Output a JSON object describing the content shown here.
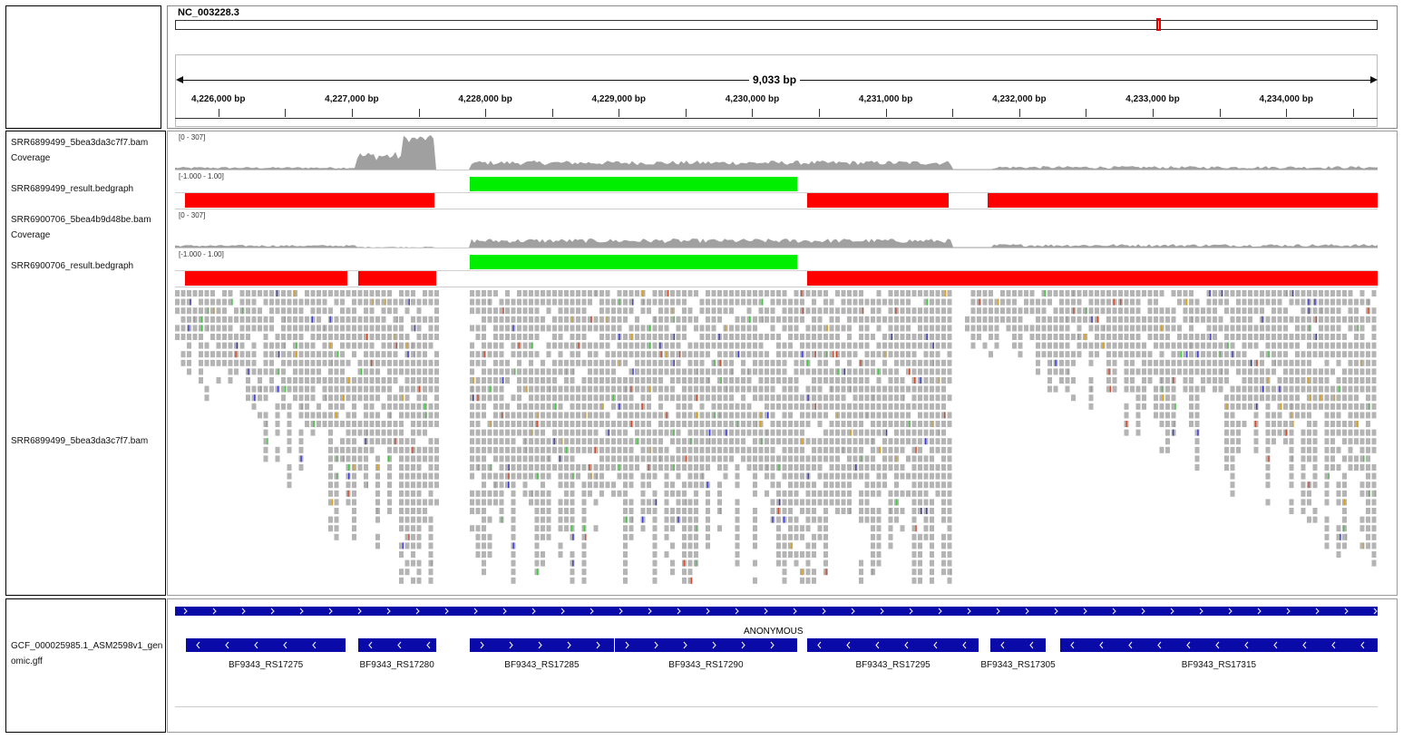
{
  "header": {
    "chromosome": "NC_003228.3",
    "span_label": "9,033 bp",
    "ticks": [
      {
        "label": "4,226,000 bp",
        "pos": 0.036
      },
      {
        "label": "4,227,000 bp",
        "pos": 0.147
      },
      {
        "label": "4,228,000 bp",
        "pos": 0.258
      },
      {
        "label": "4,229,000 bp",
        "pos": 0.369
      },
      {
        "label": "4,230,000 bp",
        "pos": 0.48
      },
      {
        "label": "4,231,000 bp",
        "pos": 0.591
      },
      {
        "label": "4,232,000 bp",
        "pos": 0.702
      },
      {
        "label": "4,233,000 bp",
        "pos": 0.813
      },
      {
        "label": "4,234,000 bp",
        "pos": 0.924
      }
    ]
  },
  "tracks": {
    "cov1": {
      "name": "SRR6899499_5bea3da3c7f7.bam Coverage",
      "range": "[0 - 307]"
    },
    "bg1": {
      "name": "SRR6899499_result.bedgraph",
      "range": "[-1.000 - 1.00]"
    },
    "cov2": {
      "name": "SRR6900706_5bea4b9d48be.bam Coverage",
      "range": "[0 - 307]"
    },
    "bg2": {
      "name": "SRR6900706_result.bedgraph",
      "range": "[-1.000 - 1.00]"
    },
    "reads": {
      "name": "SRR6899499_5bea3da3c7f7.bam"
    },
    "gff": {
      "name": "GCF_000025985.1_ASM2598v1_genomic.gff",
      "feature_label": "ANONYMOUS"
    }
  },
  "bedgraph1": [
    {
      "start": 0.008,
      "end": 0.216,
      "color": "#ff0000",
      "sign": "neg"
    },
    {
      "start": 0.245,
      "end": 0.517,
      "color": "#00ee00",
      "sign": "pos"
    },
    {
      "start": 0.526,
      "end": 0.643,
      "color": "#ff0000",
      "sign": "neg"
    },
    {
      "start": 0.676,
      "end": 1.0,
      "color": "#ff0000",
      "sign": "neg"
    }
  ],
  "bedgraph2": [
    {
      "start": 0.008,
      "end": 0.143,
      "color": "#ff0000",
      "sign": "neg"
    },
    {
      "start": 0.152,
      "end": 0.217,
      "color": "#ff0000",
      "sign": "neg"
    },
    {
      "start": 0.245,
      "end": 0.517,
      "color": "#00ee00",
      "sign": "pos"
    },
    {
      "start": 0.526,
      "end": 1.0,
      "color": "#ff0000",
      "sign": "neg"
    }
  ],
  "genes": [
    {
      "label": "BF9343_RS17275",
      "start": 0.009,
      "end": 0.142,
      "strand": "-"
    },
    {
      "label": "BF9343_RS17280",
      "start": 0.152,
      "end": 0.217,
      "strand": "-"
    },
    {
      "label": "BF9343_RS17285",
      "start": 0.245,
      "end": 0.365,
      "strand": "+"
    },
    {
      "label": "BF9343_RS17290",
      "start": 0.366,
      "end": 0.517,
      "strand": "+"
    },
    {
      "label": "BF9343_RS17295",
      "start": 0.526,
      "end": 0.668,
      "strand": "-"
    },
    {
      "label": "BF9343_RS17305",
      "start": 0.678,
      "end": 0.724,
      "strand": "-"
    },
    {
      "label": "BF9343_RS17315",
      "start": 0.736,
      "end": 1.0,
      "strand": "-"
    }
  ],
  "colors": {
    "positive": "#00ee00",
    "negative": "#ff0000",
    "coverage": "#a0a0a0",
    "read": "#b4b4b4",
    "gene": "#0a0aa8"
  }
}
